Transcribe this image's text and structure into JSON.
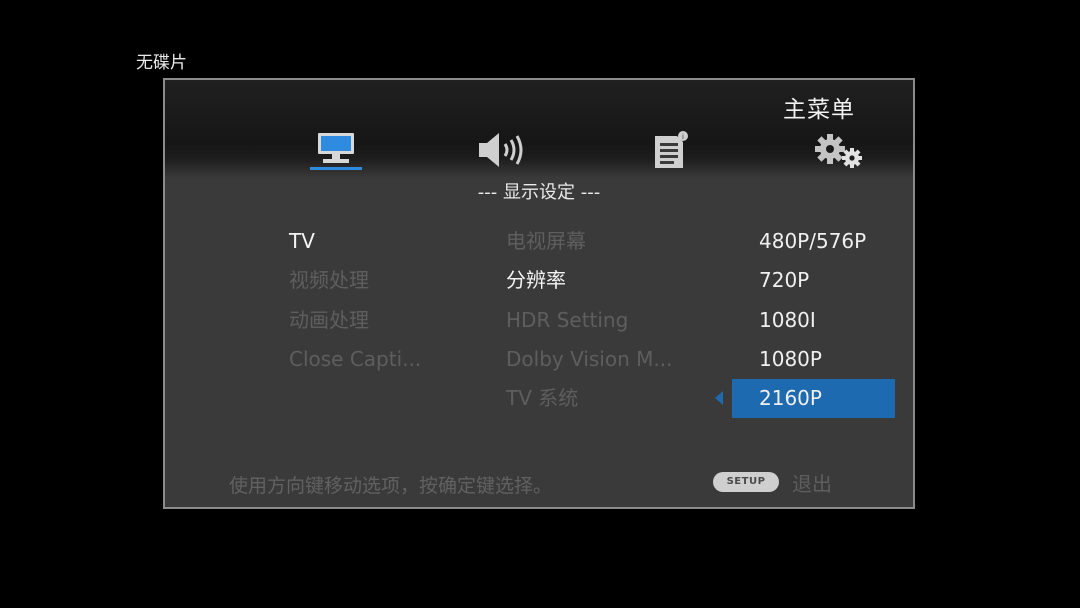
{
  "status_text": "无碟片",
  "menu": {
    "title": "主菜单",
    "tabs": [
      {
        "name": "display-icon",
        "active": true
      },
      {
        "name": "speaker-icon",
        "active": false
      },
      {
        "name": "language-icon",
        "active": false
      },
      {
        "name": "settings-gears-icon",
        "active": false
      }
    ],
    "section_title": "--- 显示设定 ---",
    "categories": [
      "TV",
      "视频处理",
      "动画处理",
      "Close Capti..."
    ],
    "settings": [
      "电视屏幕",
      "分辨率",
      "HDR Setting",
      "Dolby Vision M...",
      "TV 系统"
    ],
    "options": [
      "480P/576P",
      "720P",
      "1080I",
      "1080P",
      "2160P"
    ],
    "selected_option": "2160P",
    "hint": "使用方向键移动选项，按确定键选择。",
    "setup_key": "SETUP",
    "exit_label": "退出"
  },
  "colors": {
    "accent": "#1d6ab1",
    "panel": "#3a3a3a",
    "dim_text": "#5e5e5e"
  }
}
